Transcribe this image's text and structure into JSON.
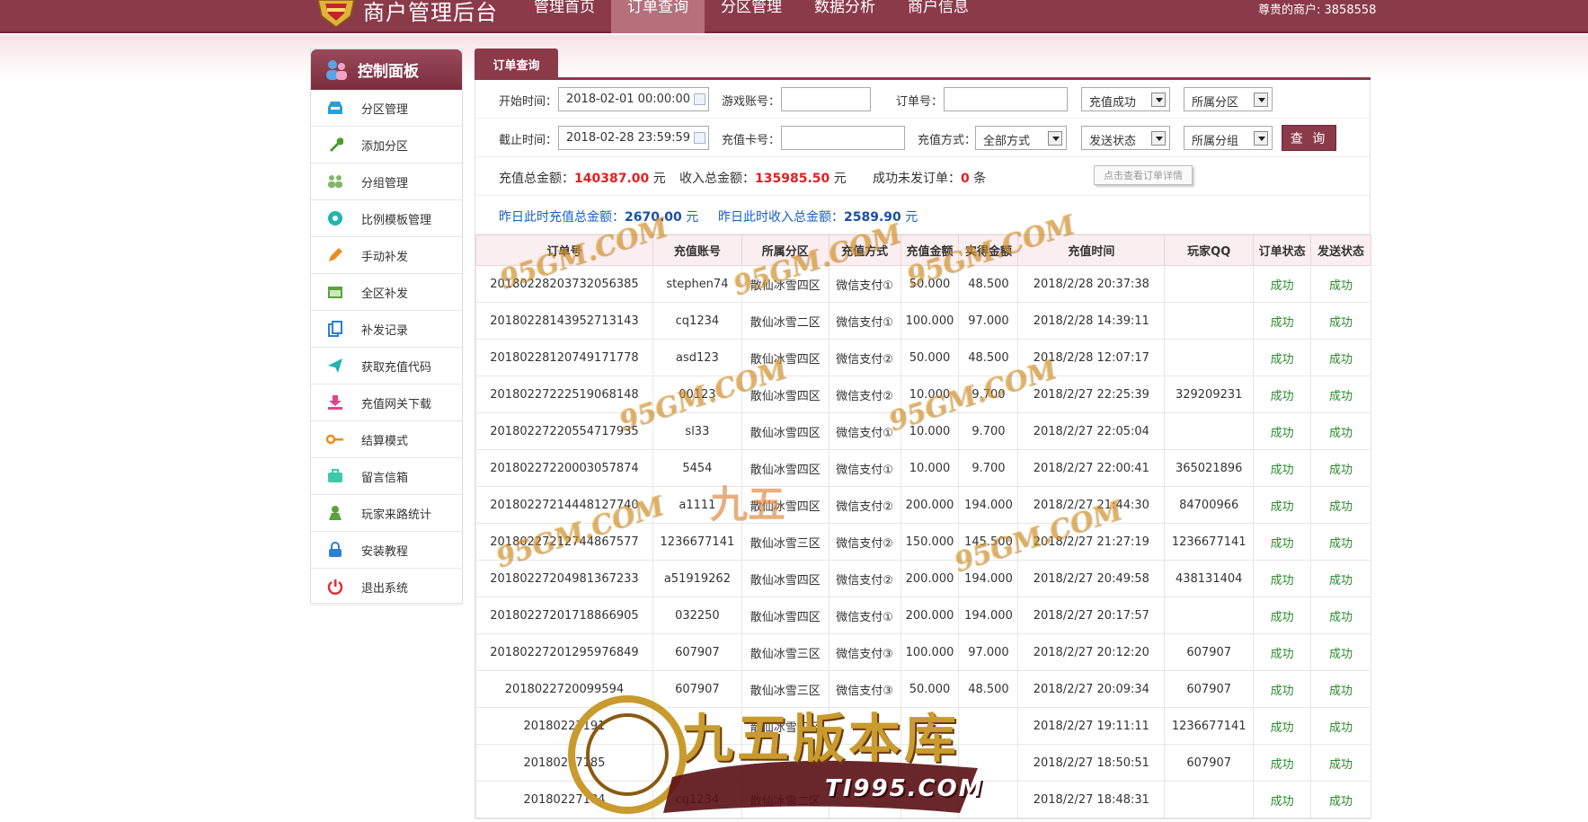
{
  "colors": {
    "brand": "#8b3a4a",
    "brand_light": "#b5707c",
    "red_value": "#e02020",
    "blue_value": "#1a4fa8",
    "success": "#2a8a2a"
  },
  "header": {
    "site_title": "商户管理后台",
    "nav": [
      "管理首页",
      "订单查询",
      "分区管理",
      "数据分析",
      "商户信息"
    ],
    "active_nav": "订单查询",
    "merchant_label": "尊贵的商户: 3858558"
  },
  "sidebar": {
    "title": "控制面板",
    "items": [
      {
        "label": "分区管理",
        "icon": "inbox-icon"
      },
      {
        "label": "添加分区",
        "icon": "wrench-icon"
      },
      {
        "label": "分组管理",
        "icon": "users-icon"
      },
      {
        "label": "比例模板管理",
        "icon": "gear-icon"
      },
      {
        "label": "手动补发",
        "icon": "pencil-icon"
      },
      {
        "label": "全区补发",
        "icon": "calendar-icon"
      },
      {
        "label": "补发记录",
        "icon": "copy-icon"
      },
      {
        "label": "获取充值代码",
        "icon": "send-icon"
      },
      {
        "label": "充值网关下载",
        "icon": "download-icon"
      },
      {
        "label": "结算模式",
        "icon": "key-icon"
      },
      {
        "label": "留言信箱",
        "icon": "briefcase-icon"
      },
      {
        "label": "玩家来路统计",
        "icon": "user-icon"
      },
      {
        "label": "安装教程",
        "icon": "lock-icon"
      },
      {
        "label": "退出系统",
        "icon": "power-icon"
      }
    ]
  },
  "tab": {
    "label": "订单查询"
  },
  "form": {
    "start_label": "开始时间：",
    "start_value": "2018-02-01 00:00:00",
    "account_label": "游戏账号：",
    "account_value": "",
    "order_label": "订单号：",
    "order_value": "",
    "status_select": "充值成功",
    "zone_select": "所属分区",
    "end_label": "截止时间：",
    "end_value": "2018-02-28 23:59:59",
    "card_label": "充值卡号：",
    "card_value": "",
    "method_label": "充值方式：",
    "method_select": "全部方式",
    "send_select": "发送状态",
    "group_select": "所属分组",
    "query_button": "查 询"
  },
  "summary": {
    "recharge_label": "充值总金额：",
    "recharge_value": "140387.00",
    "income_label": "收入总金额：",
    "income_value": "135985.50",
    "unsent_label": "成功未发订单：",
    "unsent_value": "0",
    "unit_yuan": "元",
    "unit_tiao": "条",
    "tip": "点击查看订单详情",
    "yesterday_recharge_label": "昨日此时充值总金额：",
    "yesterday_recharge_value": "2670.00",
    "yesterday_income_label": "昨日此时收入总金额：",
    "yesterday_income_value": "2589.90"
  },
  "table": {
    "headers": [
      "订单号",
      "充值账号",
      "所属分区",
      "充值方式",
      "充值金额",
      "实得金额",
      "充值时间",
      "玩家QQ",
      "订单状态",
      "发送状态"
    ],
    "rows": [
      [
        "201802282037320563​85",
        "stephen74",
        "散仙冰雪四区",
        "微信支付①",
        "50.000",
        "48.500",
        "2018/2/28 20:37:38",
        "",
        "成功",
        "成功"
      ],
      [
        "20180228143952713143",
        "cq1234",
        "散仙冰雪二区",
        "微信支付①",
        "100.000",
        "97.000",
        "2018/2/28 14:39:11",
        "",
        "成功",
        "成功"
      ],
      [
        "20180228120749171778",
        "asd123",
        "散仙冰雪四区",
        "微信支付②",
        "50.000",
        "48.500",
        "2018/2/28 12:07:17",
        "",
        "成功",
        "成功"
      ],
      [
        "20180227222519068148",
        "00123",
        "散仙冰雪四区",
        "微信支付②",
        "10.000",
        "9.700",
        "2018/2/27 22:25:39",
        "329209231",
        "成功",
        "成功"
      ],
      [
        "20180227220554717935",
        "sl33",
        "散仙冰雪四区",
        "微信支付①",
        "10.000",
        "9.700",
        "2018/2/27 22:05:04",
        "",
        "成功",
        "成功"
      ],
      [
        "20180227220003057874",
        "5454",
        "散仙冰雪四区",
        "微信支付①",
        "10.000",
        "9.700",
        "2018/2/27 22:00:41",
        "365021896",
        "成功",
        "成功"
      ],
      [
        "20180227214448127740",
        "a1111",
        "散仙冰雪四区",
        "微信支付②",
        "200.000",
        "194.000",
        "2018/2/27 21:44:30",
        "84700966",
        "成功",
        "成功"
      ],
      [
        "20180227212744867577",
        "1236677141",
        "散仙冰雪三区",
        "微信支付②",
        "150.000",
        "145.500",
        "2018/2/27 21:27:19",
        "1236677141",
        "成功",
        "成功"
      ],
      [
        "20180227204981367233",
        "a51919262",
        "散仙冰雪四区",
        "微信支付②",
        "200.000",
        "194.000",
        "2018/2/27 20:49:58",
        "438131404",
        "成功",
        "成功"
      ],
      [
        "20180227201718866905",
        "032250",
        "散仙冰雪四区",
        "微信支付①",
        "200.000",
        "194.000",
        "2018/2/27 20:17:57",
        "",
        "成功",
        "成功"
      ],
      [
        "20180227201295976849",
        "607907",
        "散仙冰雪三区",
        "微信支付③",
        "100.000",
        "97.000",
        "2018/2/27 20:12:20",
        "607907",
        "成功",
        "成功"
      ],
      [
        "2018022720099594",
        "607907",
        "散仙冰雪三区",
        "微信支付③",
        "50.000",
        "48.500",
        "2018/2/27 20:09:34",
        "607907",
        "成功",
        "成功"
      ],
      [
        "20180227191",
        "",
        "散仙冰雪四区",
        "",
        "",
        "",
        "2018/2/27 19:11:11",
        "1236677141",
        "成功",
        "成功"
      ],
      [
        "20180227185",
        "",
        "",
        "",
        "",
        "",
        "2018/2/27 18:50:51",
        "607907",
        "成功",
        "成功"
      ],
      [
        "20180227184",
        "cq1234",
        "散仙冰雪二区",
        "",
        "",
        "",
        "2018/2/27 18:48:31",
        "",
        "成功",
        "成功"
      ]
    ]
  },
  "watermarks": {
    "small": "95GM.COM",
    "big_title": "九五版本库",
    "big_url": "TI995.COM",
    "mid_title": "九五"
  }
}
